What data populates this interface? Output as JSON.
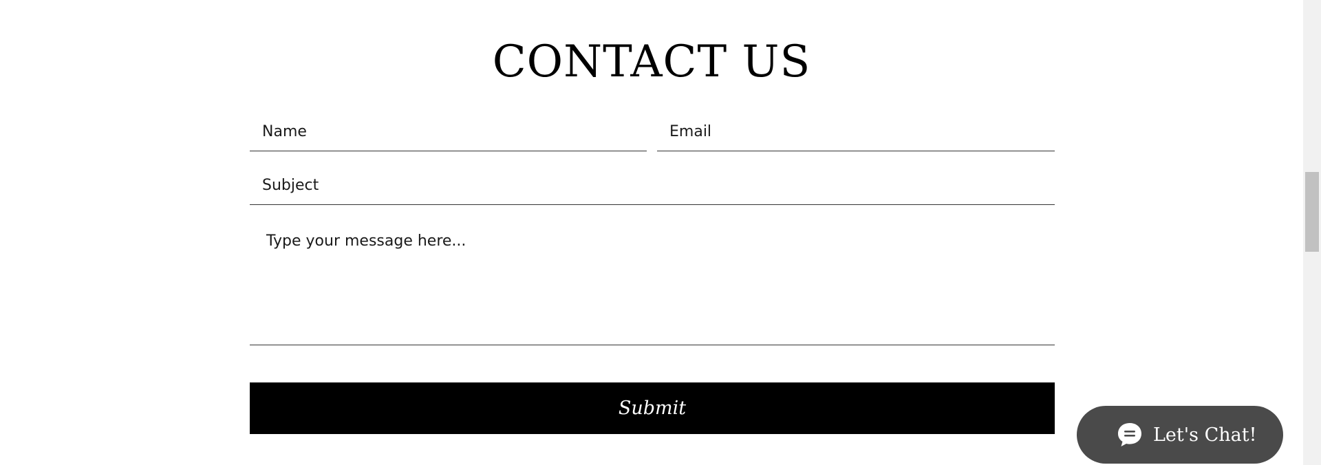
{
  "contact": {
    "title": "CONTACT US",
    "name_placeholder": "Name",
    "email_placeholder": "Email",
    "subject_placeholder": "Subject",
    "message_placeholder": "Type your message here...",
    "submit_label": "Submit"
  },
  "chat": {
    "label": "Let's Chat!",
    "icon": "chat-bubble-icon",
    "background_color": "#4a4a4a"
  },
  "colors": {
    "button_background": "#000000",
    "button_text": "#ffffff",
    "page_background": "#ffffff"
  }
}
